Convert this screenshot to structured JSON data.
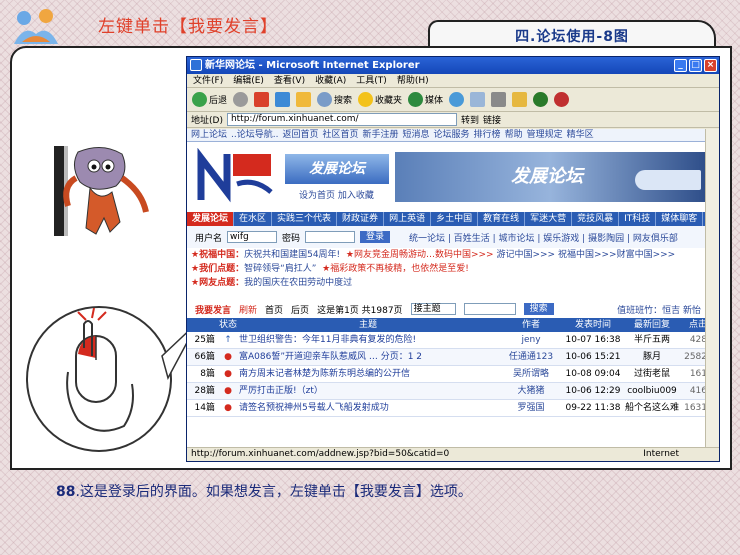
{
  "slide": {
    "title": "左键单击【我要发言】",
    "tab_label": "四.论坛使用-8图",
    "caption_number": "88",
    "caption_text": ".这是登录后的界面。如果想发言，左键单击【我要发言】选项。"
  },
  "browser": {
    "title": "新华网论坛 - Microsoft Internet Explorer",
    "menu": [
      "文件(F)",
      "编辑(E)",
      "查看(V)",
      "收藏(A)",
      "工具(T)",
      "帮助(H)"
    ],
    "toolbar": {
      "back": "后退",
      "search": "搜索",
      "favorites": "收藏夹",
      "media": "媒体"
    },
    "address_label": "地址(D)",
    "address": "http://forum.xinhuanet.com/",
    "go": "转到",
    "links": "链接",
    "status_url": "http://forum.xinhuanet.com/addnew.jsp?bid=50&catid=0",
    "status_zone": "Internet"
  },
  "forum": {
    "topnav": [
      "网上论坛",
      "..论坛导航..",
      "返回首页",
      "社区首页",
      "新手注册",
      "短消息",
      "论坛服务",
      "排行榜",
      "帮助",
      "管理规定",
      "精华区"
    ],
    "banner": {
      "slogan": "发展论坛",
      "links": "设为首页 加入收藏",
      "board_title": "发展论坛"
    },
    "categories": [
      "发展论坛",
      "在水区",
      "实践三个代表",
      "财政证券",
      "网上英语",
      "乡土中国",
      "教育在线",
      "军迷大营",
      "竞技风暴",
      "IT科技",
      "媒体聊客"
    ],
    "login": {
      "user_label": "用户名",
      "user_value": "wifg",
      "pass_label": "密码",
      "button": "登录",
      "links": "统一论坛 | 百姓生活 | 城市论坛 | 娱乐游戏 | 摄影陶园 | 网友俱乐部"
    },
    "announcements": [
      {
        "tag": "祝福中国：",
        "text": "庆祝共和国建国54周年!",
        "tag2": "网友竞金周畅游动…数码中国>>>",
        "text2": "游记中国>>>  祝福中国>>>财富中国>>>"
      },
      {
        "tag": "我们点题：",
        "text": "智碎领导“肩扛人”",
        "tag2": "福彩政策不再棱精，也依然是至爱!",
        "text2": ""
      },
      {
        "tag": "网友点题：",
        "text": "我的国庆在农田劳动中度过",
        "tag2": "",
        "text2": ""
      }
    ],
    "controls": {
      "post": "我要发言",
      "refresh": "刷新",
      "first": "首页",
      "last": "后页",
      "page_info": "这是第1页 共1987页",
      "select": "接主题",
      "search_btn": "搜索",
      "right": "值班班竹：恒吉 新怡"
    },
    "table_headers": {
      "status": "状态",
      "title": "主题",
      "author": "作者",
      "time": "发表时间",
      "reply": "最新回复",
      "clicks": "点击"
    },
    "rows": [
      {
        "num": "25篇",
        "title": "世卫组织警告：今年11月非典有复发的危险!",
        "author": "jeny",
        "time": "10-07 16:38",
        "reply": "半斤五两",
        "clicks": "428"
      },
      {
        "num": "66篇",
        "title": "富A086誓”开道迎亲车队惹威风 … 分页：1 2",
        "author": "任通通123",
        "time": "10-06 15:21",
        "reply": "豚月",
        "clicks": "2582"
      },
      {
        "num": "8篇",
        "title": "南方周末记者林楚为陈新东明总编的公开信",
        "author": "吴所谓略",
        "time": "10-08 09:04",
        "reply": "过街老鼠",
        "clicks": "161"
      },
      {
        "num": "28篇",
        "title": "严厉打击正版!（zt）",
        "author": "大猪猪",
        "time": "10-06 12:29",
        "reply": "coolbiu009",
        "clicks": "416"
      },
      {
        "num": "14篇",
        "title": "请签名预祝神州5号载人飞船发射成功",
        "author": "罗强国",
        "time": "09-22 11:38",
        "reply": "船个名这么难",
        "clicks": "1631"
      }
    ]
  }
}
